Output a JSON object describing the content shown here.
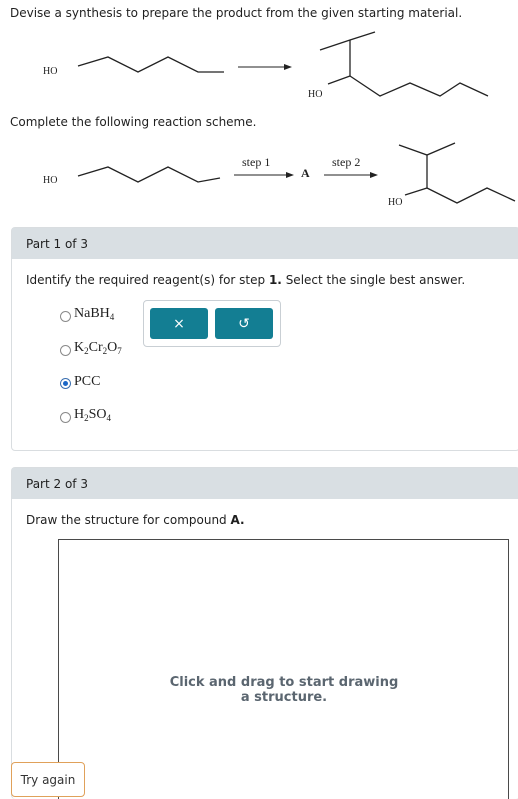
{
  "prompt": "Devise a synthesis to prepare the product from the given starting material.",
  "scheme_instruction": "Complete the following reaction scheme.",
  "labels": {
    "ho": "HO",
    "step1": "step 1",
    "step2": "step 2",
    "intermediate": "A"
  },
  "part1": {
    "header": "Part 1 of 3",
    "question_prefix": "Identify the required reagent(s) for step ",
    "question_step": "1.",
    "question_suffix": " Select the single best answer.",
    "options": [
      {
        "main": "NaBH",
        "sub": "4",
        "selected": false
      },
      {
        "formula": [
          "K",
          "2",
          "Cr",
          "2",
          "O",
          "7"
        ],
        "selected": false
      },
      {
        "main": "PCC",
        "selected": true
      },
      {
        "main": "H",
        "sub": "2",
        "rest": "SO",
        "sub2": "4",
        "selected": false
      }
    ],
    "buttons": {
      "clear": "×",
      "undo": "↺"
    }
  },
  "part2": {
    "header": "Part 2 of 3",
    "question_prefix": "Draw the structure for compound ",
    "question_bold": "A.",
    "canvas_hint": "Click and drag to start drawing a structure."
  },
  "try_again": "Try again"
}
